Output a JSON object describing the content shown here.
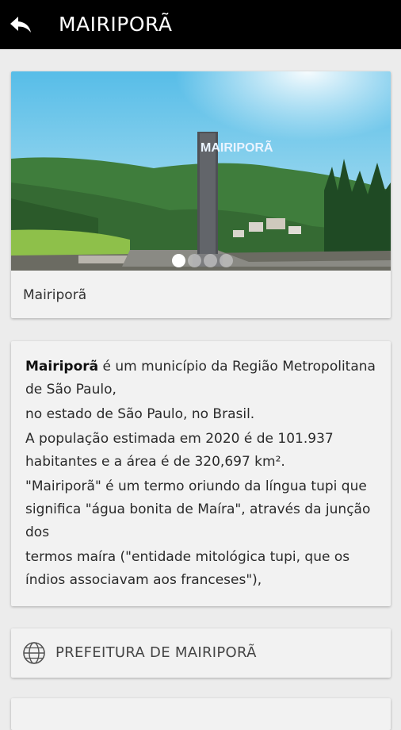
{
  "header": {
    "title": "MAIRIPORÃ",
    "back_icon": "back-arrow-icon"
  },
  "gallery": {
    "caption": "Mairiporã",
    "monument_text": "MAIRIPORÃ",
    "slide_count": 4,
    "active_slide": 1
  },
  "description": {
    "bold_name": "Mairiporã",
    "line1_rest": " é um município da Região Metropolitana de São Paulo,",
    "line2": "no estado de São Paulo, no Brasil.",
    "line3": "A população estimada em 2020 é de 101.937 habitantes e a área é de 320,697 km².",
    "line4": "\"Mairiporã\" é um termo oriundo da língua tupi que significa \"água bonita de Maíra\", através da junção dos",
    "line5": "termos maíra (\"entidade mitológica tupi, que os índios associavam aos franceses\"),"
  },
  "links": [
    {
      "icon": "globe-icon",
      "label": "PREFEITURA DE MAIRIPORÃ"
    }
  ],
  "colors": {
    "topbar": "#000000",
    "background": "#ececec",
    "card": "#f2f2f2"
  }
}
